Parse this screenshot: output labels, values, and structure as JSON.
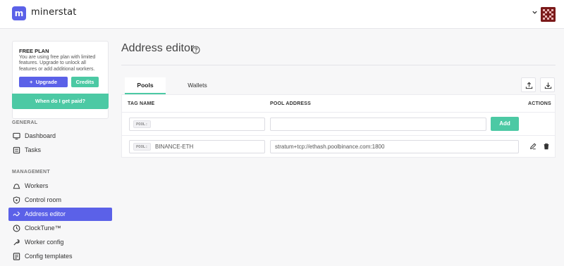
{
  "app": {
    "logo_letter": "m",
    "name": "minerstat"
  },
  "plan": {
    "title": "FREE PLAN",
    "description": "You are using free plan with limited features. Upgrade to unlock all features or add additional workers.",
    "upgrade_label": "Upgrade",
    "upgrade_prefix": "+",
    "credits_label": "Credits",
    "paid_label": "When do I get paid?"
  },
  "nav": {
    "general_label": "GENERAL",
    "management_label": "MANAGEMENT",
    "items": [
      {
        "label": "Dashboard",
        "icon": "monitor-icon"
      },
      {
        "label": "Tasks",
        "icon": "tasks-icon"
      },
      {
        "label": "Workers",
        "icon": "workers-icon"
      },
      {
        "label": "Control room",
        "icon": "shield-icon"
      },
      {
        "label": "Address editor",
        "icon": "address-editor-icon",
        "active": true
      },
      {
        "label": "ClockTune™",
        "icon": "clock-icon"
      },
      {
        "label": "Worker config",
        "icon": "wrench-icon"
      },
      {
        "label": "Config templates",
        "icon": "template-icon"
      }
    ]
  },
  "main": {
    "title": "Address editor",
    "tabs": [
      {
        "label": "Pools",
        "active": true
      },
      {
        "label": "Wallets"
      }
    ],
    "table": {
      "headers": {
        "tag": "TAG NAME",
        "address": "POOL ADDRESS",
        "actions": "ACTIONS"
      },
      "new_row": {
        "tag_prefix": "POOL:",
        "tag_value": "",
        "address_value": "",
        "add_label": "Add"
      },
      "rows": [
        {
          "tag_prefix": "POOL:",
          "tag_value": "BINANCE-ETH",
          "address_value": "stratum+tcp://ethash.poolbinance.com:1800"
        }
      ]
    }
  },
  "colors": {
    "accent": "#5b61e8",
    "green": "#4cc9a4"
  }
}
